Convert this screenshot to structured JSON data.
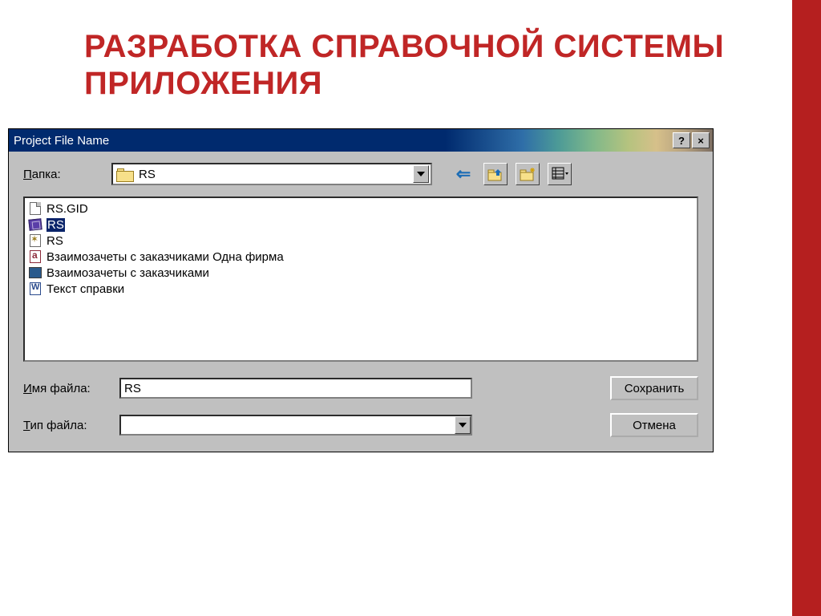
{
  "slide": {
    "title": "РАЗРАБОТКА СПРАВОЧНОЙ СИСТЕМЫ ПРИЛОЖЕНИЯ"
  },
  "dialog": {
    "title": "Project File Name",
    "help_glyph": "?",
    "close_glyph": "×",
    "folder_label": "Папка:",
    "folder_value": "RS",
    "files": [
      {
        "name": "RS.GID",
        "icon": "page",
        "selected": false
      },
      {
        "name": "RS",
        "icon": "book",
        "selected": true
      },
      {
        "name": "RS",
        "icon": "cfg",
        "selected": false
      },
      {
        "name": "Взаимозачеты с заказчиками Одна фирма",
        "icon": "rtf",
        "selected": false
      },
      {
        "name": "Взаимозачеты с заказчиками",
        "icon": "scr",
        "selected": false
      },
      {
        "name": "Текст  справки",
        "icon": "doc",
        "selected": false
      }
    ],
    "filename_label": "Имя файла:",
    "filename_value": "RS",
    "filetype_label": "Тип файла:",
    "filetype_value": "",
    "save_label": "Сохранить",
    "cancel_label": "Отмена"
  }
}
